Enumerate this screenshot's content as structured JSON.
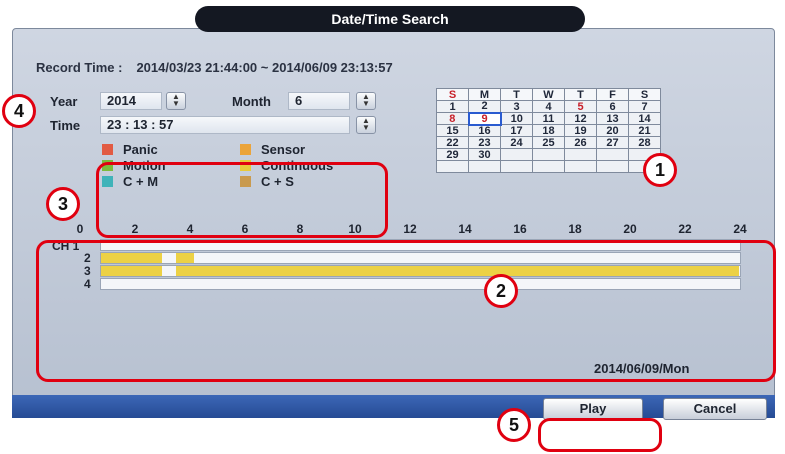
{
  "title": "Date/Time Search",
  "record_time": {
    "label": "Record Time :",
    "value": "2014/03/23 21:44:00 ~ 2014/06/09 23:13:57"
  },
  "fields": {
    "year_label": "Year",
    "year_value": "2014",
    "month_label": "Month",
    "month_value": "6",
    "time_label": "Time",
    "time_value": "23 : 13 : 57"
  },
  "legend": [
    {
      "label": "Panic",
      "color": "#e25b43"
    },
    {
      "label": "Sensor",
      "color": "#eba43a"
    },
    {
      "label": "Motion",
      "color": "#7dbb3c"
    },
    {
      "label": "Continuous",
      "color": "#e8c93a"
    },
    {
      "label": "C + M",
      "color": "#3fb3b9"
    },
    {
      "label": "C + S",
      "color": "#c99a4e"
    }
  ],
  "calendar": {
    "weekdays": [
      "S",
      "M",
      "T",
      "W",
      "T",
      "F",
      "S"
    ],
    "weeks": [
      [
        "1",
        "2",
        "3",
        "4",
        "5",
        "6",
        "7"
      ],
      [
        "8",
        "9",
        "10",
        "11",
        "12",
        "13",
        "14"
      ],
      [
        "15",
        "16",
        "17",
        "18",
        "19",
        "20",
        "21"
      ],
      [
        "22",
        "23",
        "24",
        "25",
        "26",
        "27",
        "28"
      ],
      [
        "29",
        "30",
        "",
        "",
        "",
        "",
        ""
      ],
      [
        "",
        "",
        "",
        "",
        "",
        "",
        ""
      ]
    ],
    "selected_day": "9",
    "recorded_days_red": [
      "5",
      "8",
      "9"
    ]
  },
  "timeline": {
    "hour_labels": [
      "0",
      "2",
      "4",
      "6",
      "8",
      "10",
      "12",
      "14",
      "16",
      "18",
      "20",
      "22",
      "24"
    ],
    "channel_label": "CH 1",
    "channels": [
      "1",
      "2",
      "3",
      "4"
    ],
    "recordings": [
      {
        "channel": 2,
        "start_hour": 0.0,
        "end_hour": 2.3
      },
      {
        "channel": 2,
        "start_hour": 2.8,
        "end_hour": 3.5
      },
      {
        "channel": 3,
        "start_hour": 0.0,
        "end_hour": 2.3
      },
      {
        "channel": 3,
        "start_hour": 2.8,
        "end_hour": 23.9
      }
    ],
    "date": "2014/06/09/Mon"
  },
  "buttons": {
    "play": "Play",
    "cancel": "Cancel"
  },
  "annotations": [
    "1",
    "2",
    "3",
    "4",
    "5"
  ]
}
